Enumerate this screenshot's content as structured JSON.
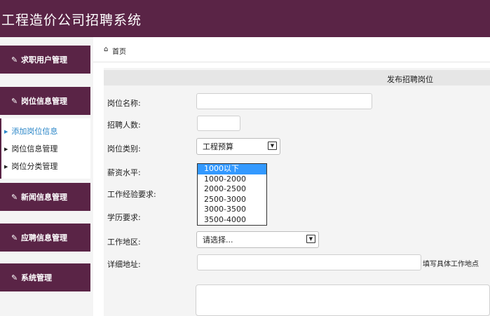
{
  "app": {
    "title": "工程造价公司招聘系统"
  },
  "sidebar": {
    "menus": [
      {
        "label": "求职用户管理",
        "icon": "edit-icon"
      },
      {
        "label": "岗位信息管理",
        "icon": "edit-icon"
      },
      {
        "label": "新闻信息管理",
        "icon": "edit-icon"
      },
      {
        "label": "应聘信息管理",
        "icon": "edit-icon"
      },
      {
        "label": "系统管理",
        "icon": "edit-icon"
      }
    ],
    "submenu": [
      {
        "label": "添加岗位信息",
        "active": true
      },
      {
        "label": "岗位信息管理",
        "active": false
      },
      {
        "label": "岗位分类管理",
        "active": false
      }
    ]
  },
  "breadcrumb": {
    "icon": "home-icon",
    "label": "首页"
  },
  "form": {
    "title": "发布招聘岗位",
    "fields": {
      "job_name": {
        "label": "岗位名称:",
        "value": ""
      },
      "headcount": {
        "label": "招聘人数:",
        "value": ""
      },
      "category": {
        "label": "岗位类别:",
        "value": "工程预算"
      },
      "salary": {
        "label": "薪资水平:",
        "options": [
          "1000以下",
          "1000-2000",
          "2000-2500",
          "2500-3000",
          "3000-3500",
          "3500-4000"
        ],
        "highlighted": "1000以下"
      },
      "experience": {
        "label": "工作经验要求:"
      },
      "education": {
        "label": "学历要求:"
      },
      "region": {
        "label": "工作地区:",
        "value": "请选择..."
      },
      "address": {
        "label": "详细地址:",
        "value": "",
        "hint": "填写具体工作地点"
      }
    }
  },
  "colors": {
    "brand": "#5a2446",
    "active_link": "#2a86c8",
    "highlight": "#3399ff"
  }
}
